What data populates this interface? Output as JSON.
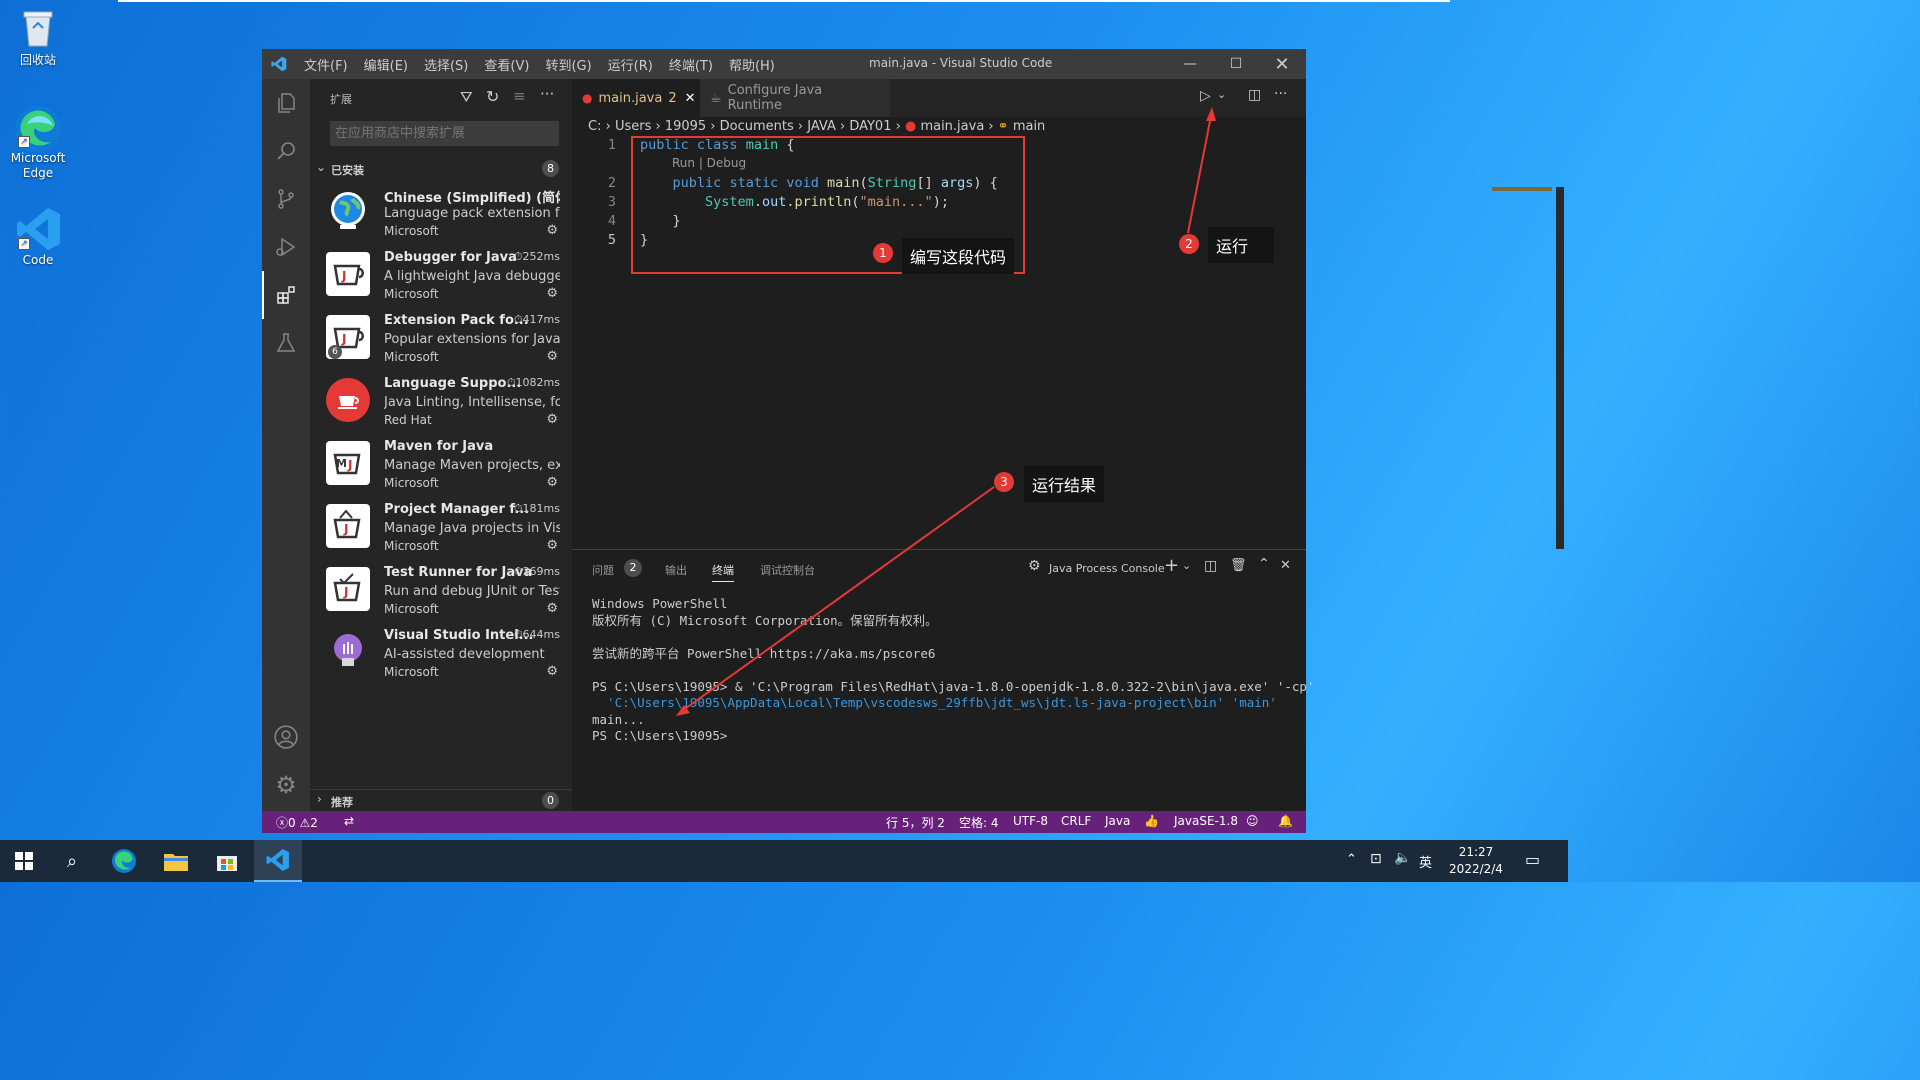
{
  "desktop": {
    "icons": [
      {
        "label": "回收站"
      },
      {
        "label": "Microsoft Edge"
      },
      {
        "label": "Code"
      }
    ]
  },
  "window": {
    "title": "main.java - Visual Studio Code",
    "menu": [
      "文件(F)",
      "编辑(E)",
      "选择(S)",
      "查看(V)",
      "转到(G)",
      "运行(R)",
      "终端(T)",
      "帮助(H)"
    ]
  },
  "sidebar": {
    "title": "扩展",
    "search_placeholder": "在应用商店中搜索扩展",
    "installed_label": "已安装",
    "installed_count": "8",
    "recommended_label": "推荐",
    "recommended_count": "0",
    "extensions": [
      {
        "name": "Chinese (Simplified) (简体...",
        "desc": "Language pack extension fo...",
        "publisher": "Microsoft",
        "time": ""
      },
      {
        "name": "Debugger for Java",
        "desc": "A lightweight Java debugge...",
        "publisher": "Microsoft",
        "time": "252ms"
      },
      {
        "name": "Extension Pack fo...",
        "desc": "Popular extensions for Java ...",
        "publisher": "Microsoft",
        "time": "417ms",
        "badge": "6"
      },
      {
        "name": "Language Suppo...",
        "desc": "Java Linting, Intellisense, for...",
        "publisher": "Red Hat",
        "time": "1082ms"
      },
      {
        "name": "Maven for Java",
        "desc": "Manage Maven projects, ex...",
        "publisher": "Microsoft",
        "time": ""
      },
      {
        "name": "Project Manager f...",
        "desc": "Manage Java projects in Vis...",
        "publisher": "Microsoft",
        "time": "181ms"
      },
      {
        "name": "Test Runner for Java",
        "desc": "Run and debug JUnit or Test...",
        "publisher": "Microsoft",
        "time": "369ms"
      },
      {
        "name": "Visual Studio Intel...",
        "desc": "AI-assisted development",
        "publisher": "Microsoft",
        "time": "644ms"
      }
    ]
  },
  "editor": {
    "tabs": [
      {
        "label": "main.java",
        "problems": "2"
      },
      {
        "label": "Configure Java Runtime"
      }
    ],
    "breadcrumbs": [
      "C:",
      "Users",
      "19095",
      "Documents",
      "JAVA",
      "DAY01",
      "main.java",
      "main"
    ],
    "codelens": "Run | Debug",
    "lines": [
      {
        "num": "1"
      },
      {
        "num": "2"
      },
      {
        "num": "3"
      },
      {
        "num": "4"
      },
      {
        "num": "5"
      }
    ]
  },
  "callouts": {
    "one": {
      "num": "1",
      "text": "编写这段代码"
    },
    "two": {
      "num": "2",
      "text": "运行"
    },
    "three": {
      "num": "3",
      "text": "运行结果"
    },
    "accent": "#e53935"
  },
  "panel": {
    "tabs": [
      "问题",
      "输出",
      "终端",
      "调试控制台"
    ],
    "problems_count": "2",
    "console_label": "Java Process Console",
    "terminal": [
      "Windows PowerShell",
      "版权所有 (C) Microsoft Corporation。保留所有权利。",
      "",
      "尝试新的跨平台 PowerShell https://aka.ms/pscore6",
      "",
      "PS C:\\Users\\19095> & 'C:\\Program Files\\RedHat\\java-1.8.0-openjdk-1.8.0.322-2\\bin\\java.exe' '-cp'",
      "  'C:\\Users\\19095\\AppData\\Local\\Temp\\vscodesws_29ffb\\jdt_ws\\jdt.ls-java-project\\bin' 'main'",
      "main...",
      "PS C:\\Users\\19095>"
    ]
  },
  "statusbar": {
    "errors": "0",
    "warnings": "2",
    "position": "行 5，列 2",
    "spaces": "空格: 4",
    "encoding": "UTF-8",
    "eol": "CRLF",
    "language": "Java",
    "runtime": "JavaSE-1.8",
    "color": "#68217a"
  },
  "taskbar": {
    "ime": "英",
    "time": "21:27",
    "date": "2022/2/4"
  }
}
